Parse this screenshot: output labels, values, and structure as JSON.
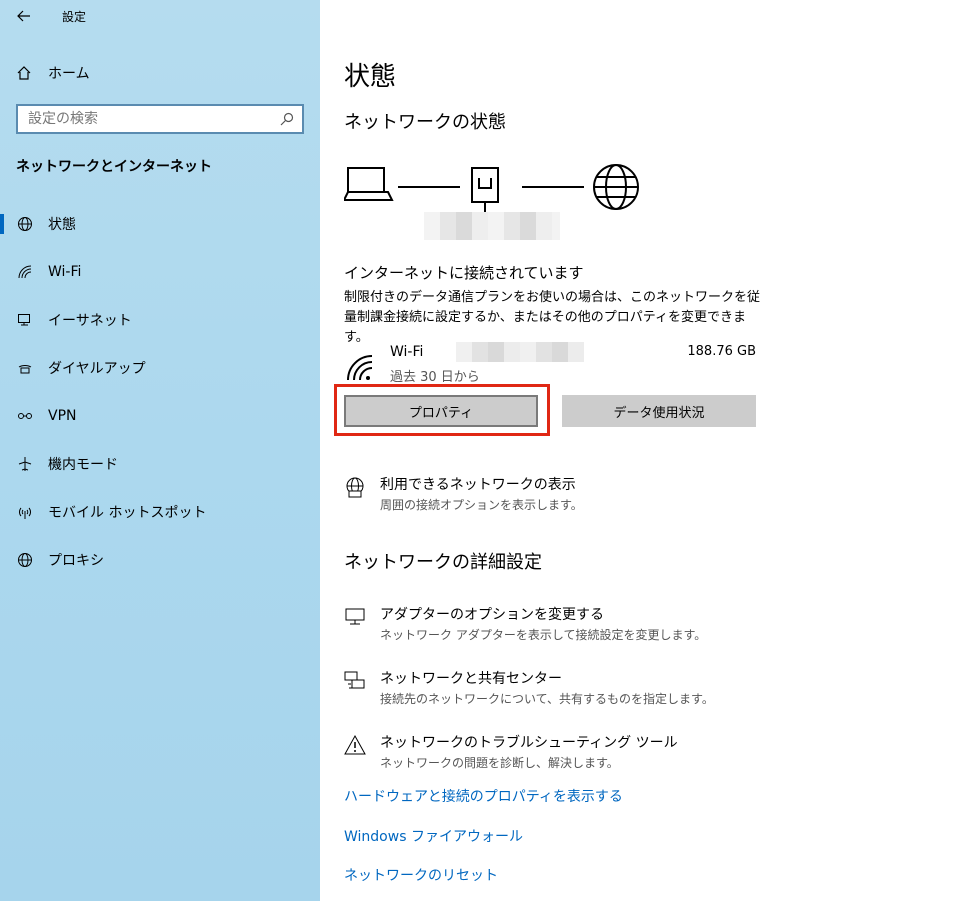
{
  "titlebar": {
    "title": "設定"
  },
  "sidebar": {
    "home": "ホーム",
    "search_placeholder": "設定の検索",
    "section": "ネットワークとインターネット",
    "items": [
      {
        "label": "状態",
        "icon": "globe-status-icon",
        "active": true
      },
      {
        "label": "Wi-Fi",
        "icon": "wifi-icon"
      },
      {
        "label": "イーサネット",
        "icon": "ethernet-icon"
      },
      {
        "label": "ダイヤルアップ",
        "icon": "dialup-icon"
      },
      {
        "label": "VPN",
        "icon": "vpn-icon"
      },
      {
        "label": "機内モード",
        "icon": "airplane-icon"
      },
      {
        "label": "モバイル ホットスポット",
        "icon": "hotspot-icon"
      },
      {
        "label": "プロキシ",
        "icon": "globe-icon"
      }
    ]
  },
  "main": {
    "title": "状態",
    "network_status": "ネットワークの状態",
    "connected": "インターネットに接続されています",
    "description": "制限付きのデータ通信プランをお使いの場合は、このネットワークを従量制課金接続に設定するか、またはその他のプロパティを変更できます。",
    "wifi": {
      "name": "Wi-Fi",
      "sub": "過去 30 日から",
      "size": "188.76 GB"
    },
    "buttons": {
      "properties": "プロパティ",
      "data_usage": "データ使用状況"
    },
    "available": {
      "title": "利用できるネットワークの表示",
      "sub": "周囲の接続オプションを表示します。"
    },
    "advanced_head": "ネットワークの詳細設定",
    "adapter": {
      "title": "アダプターのオプションを変更する",
      "sub": "ネットワーク アダプターを表示して接続設定を変更します。"
    },
    "sharing": {
      "title": "ネットワークと共有センター",
      "sub": "接続先のネットワークについて、共有するものを指定します。"
    },
    "troubleshoot": {
      "title": "ネットワークのトラブルシューティング ツール",
      "sub": "ネットワークの問題を診断し、解決します。"
    },
    "links": {
      "hardware": "ハードウェアと接続のプロパティを表示する",
      "firewall": "Windows ファイアウォール",
      "reset": "ネットワークのリセット"
    }
  },
  "colors": {
    "accent": "#0067c0",
    "highlight": "#e02814",
    "sidebar": "#acd8ee"
  }
}
